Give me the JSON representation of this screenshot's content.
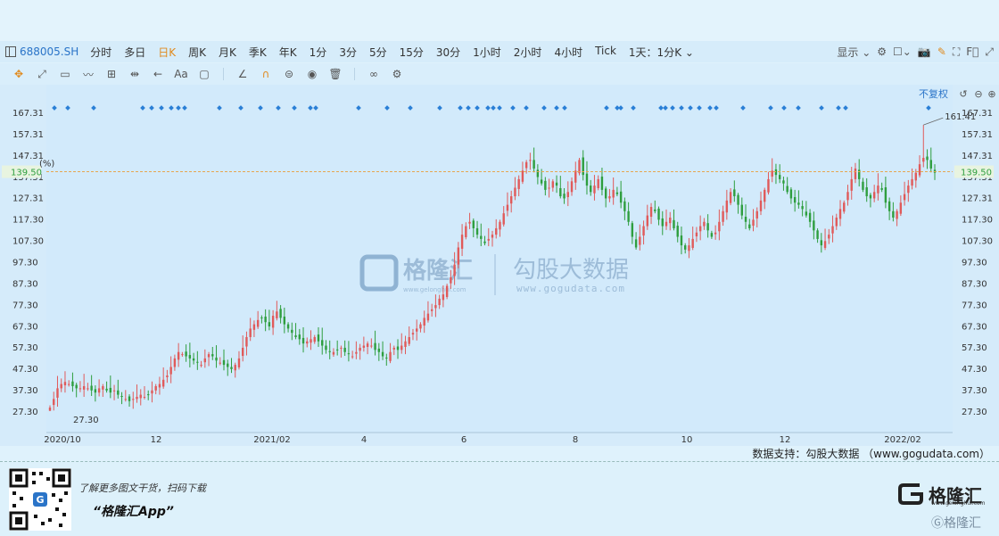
{
  "tabbar": {
    "symbol": "688005.SH",
    "tabs": [
      "分时",
      "多日",
      "日K",
      "周K",
      "月K",
      "季K",
      "年K",
      "1分",
      "3分",
      "5分",
      "15分",
      "30分",
      "1小时",
      "2小时",
      "4小时",
      "Tick",
      "1天：1分K ⌄"
    ],
    "active_tab": "日K",
    "display_label": "显示 ⌄",
    "fq_label": "F⃞"
  },
  "chart_area": {
    "restore_label": "不复权",
    "percent_label": "(%)",
    "current_price": "139.50",
    "max_label": "161.41",
    "min_label": "27.30"
  },
  "chart_data": {
    "type": "candlestick",
    "y_ticks": [
      167.31,
      157.31,
      147.31,
      137.31,
      127.31,
      117.3,
      107.3,
      97.3,
      87.3,
      77.3,
      67.3,
      57.3,
      47.3,
      37.3,
      27.3
    ],
    "y_tick_labels": [
      "167.31",
      "157.31",
      "147.31",
      "137.31",
      "127.31",
      "117.30",
      "107.30",
      "97.30",
      "87.30",
      "77.30",
      "67.30",
      "57.30",
      "47.30",
      "37.30",
      "27.30"
    ],
    "x_labels": [
      "2020/10",
      "12",
      "2021/02",
      "4",
      "6",
      "8",
      "10",
      "12",
      "2022/02"
    ],
    "current_price": 139.5,
    "high": 161.41,
    "low": 27.3,
    "close_series": [
      29,
      33,
      38,
      40,
      41,
      40,
      39,
      38,
      38,
      39,
      38,
      37,
      36,
      38,
      39,
      37,
      36,
      37,
      35,
      34,
      33,
      32,
      33,
      34,
      35,
      34,
      35,
      37,
      39,
      40,
      42,
      44,
      48,
      52,
      55,
      54,
      53,
      52,
      51,
      50,
      49,
      52,
      54,
      53,
      51,
      50,
      49,
      48,
      47,
      49,
      52,
      57,
      62,
      66,
      68,
      70,
      71,
      69,
      67,
      72,
      74,
      71,
      68,
      66,
      64,
      62,
      61,
      59,
      60,
      61,
      62,
      60,
      58,
      56,
      55,
      55,
      56,
      57,
      55,
      54,
      53,
      55,
      57,
      58,
      59,
      58,
      56,
      55,
      53,
      52,
      55,
      57,
      56,
      58,
      60,
      62,
      64,
      66,
      68,
      71,
      73,
      75,
      77,
      80,
      82,
      86,
      90,
      96,
      104,
      110,
      114,
      116,
      113,
      110,
      108,
      106,
      108,
      110,
      113,
      116,
      120,
      124,
      128,
      132,
      136,
      140,
      144,
      145,
      141,
      137,
      134,
      131,
      132,
      135,
      133,
      128,
      127,
      130,
      135,
      140,
      145,
      138,
      133,
      130,
      133,
      136,
      131,
      127,
      128,
      131,
      129,
      125,
      121,
      116,
      109,
      104,
      109,
      114,
      119,
      123,
      121,
      117,
      114,
      116,
      118,
      113,
      109,
      105,
      103,
      105,
      108,
      111,
      114,
      116,
      112,
      109,
      111,
      116,
      121,
      126,
      130,
      128,
      124,
      119,
      116,
      113,
      117,
      121,
      126,
      131,
      136,
      140,
      138,
      136,
      134,
      130,
      127,
      125,
      124,
      122,
      119,
      116,
      112,
      108,
      105,
      107,
      110,
      114,
      118,
      122,
      125,
      130,
      136,
      141,
      136,
      131,
      128,
      127,
      130,
      133,
      131,
      125,
      121,
      118,
      121,
      125,
      129,
      133,
      136,
      139,
      143,
      146,
      145,
      141,
      139
    ]
  },
  "toolbar": {
    "tools": [
      "crosshair-icon",
      "line-tool-icon",
      "rect-tool-icon",
      "wave-tool-icon",
      "measure-tool-icon",
      "range-tool-icon",
      "arrow-tool-icon",
      "text-tool-icon",
      "comment-tool-icon",
      "angle-tool-icon",
      "magnet-icon",
      "lock-icon",
      "eye-icon",
      "trash-icon",
      "compare-icon",
      "settings-icon"
    ],
    "text_tool": "Aa"
  },
  "footer": {
    "source": "数据支持：勾股大数据 （www.gogudata.com）",
    "promo_line1": "了解更多图文干货，扫码下载",
    "promo_line2": "“格隆汇App”",
    "brand_name": "格隆汇",
    "brand_url": "www.gelonghui.com",
    "brand_mini": "格隆汇"
  },
  "watermark": {
    "logo_text": "格隆汇",
    "logo_url": "www.gelonghui.com",
    "brand2": "勾股大数据",
    "brand2_url": "www.gogudata.com"
  },
  "colors": {
    "up": "#e05a5a",
    "down": "#2e9e3e",
    "marker": "#2a7fd6",
    "price_line": "#e6a650"
  }
}
